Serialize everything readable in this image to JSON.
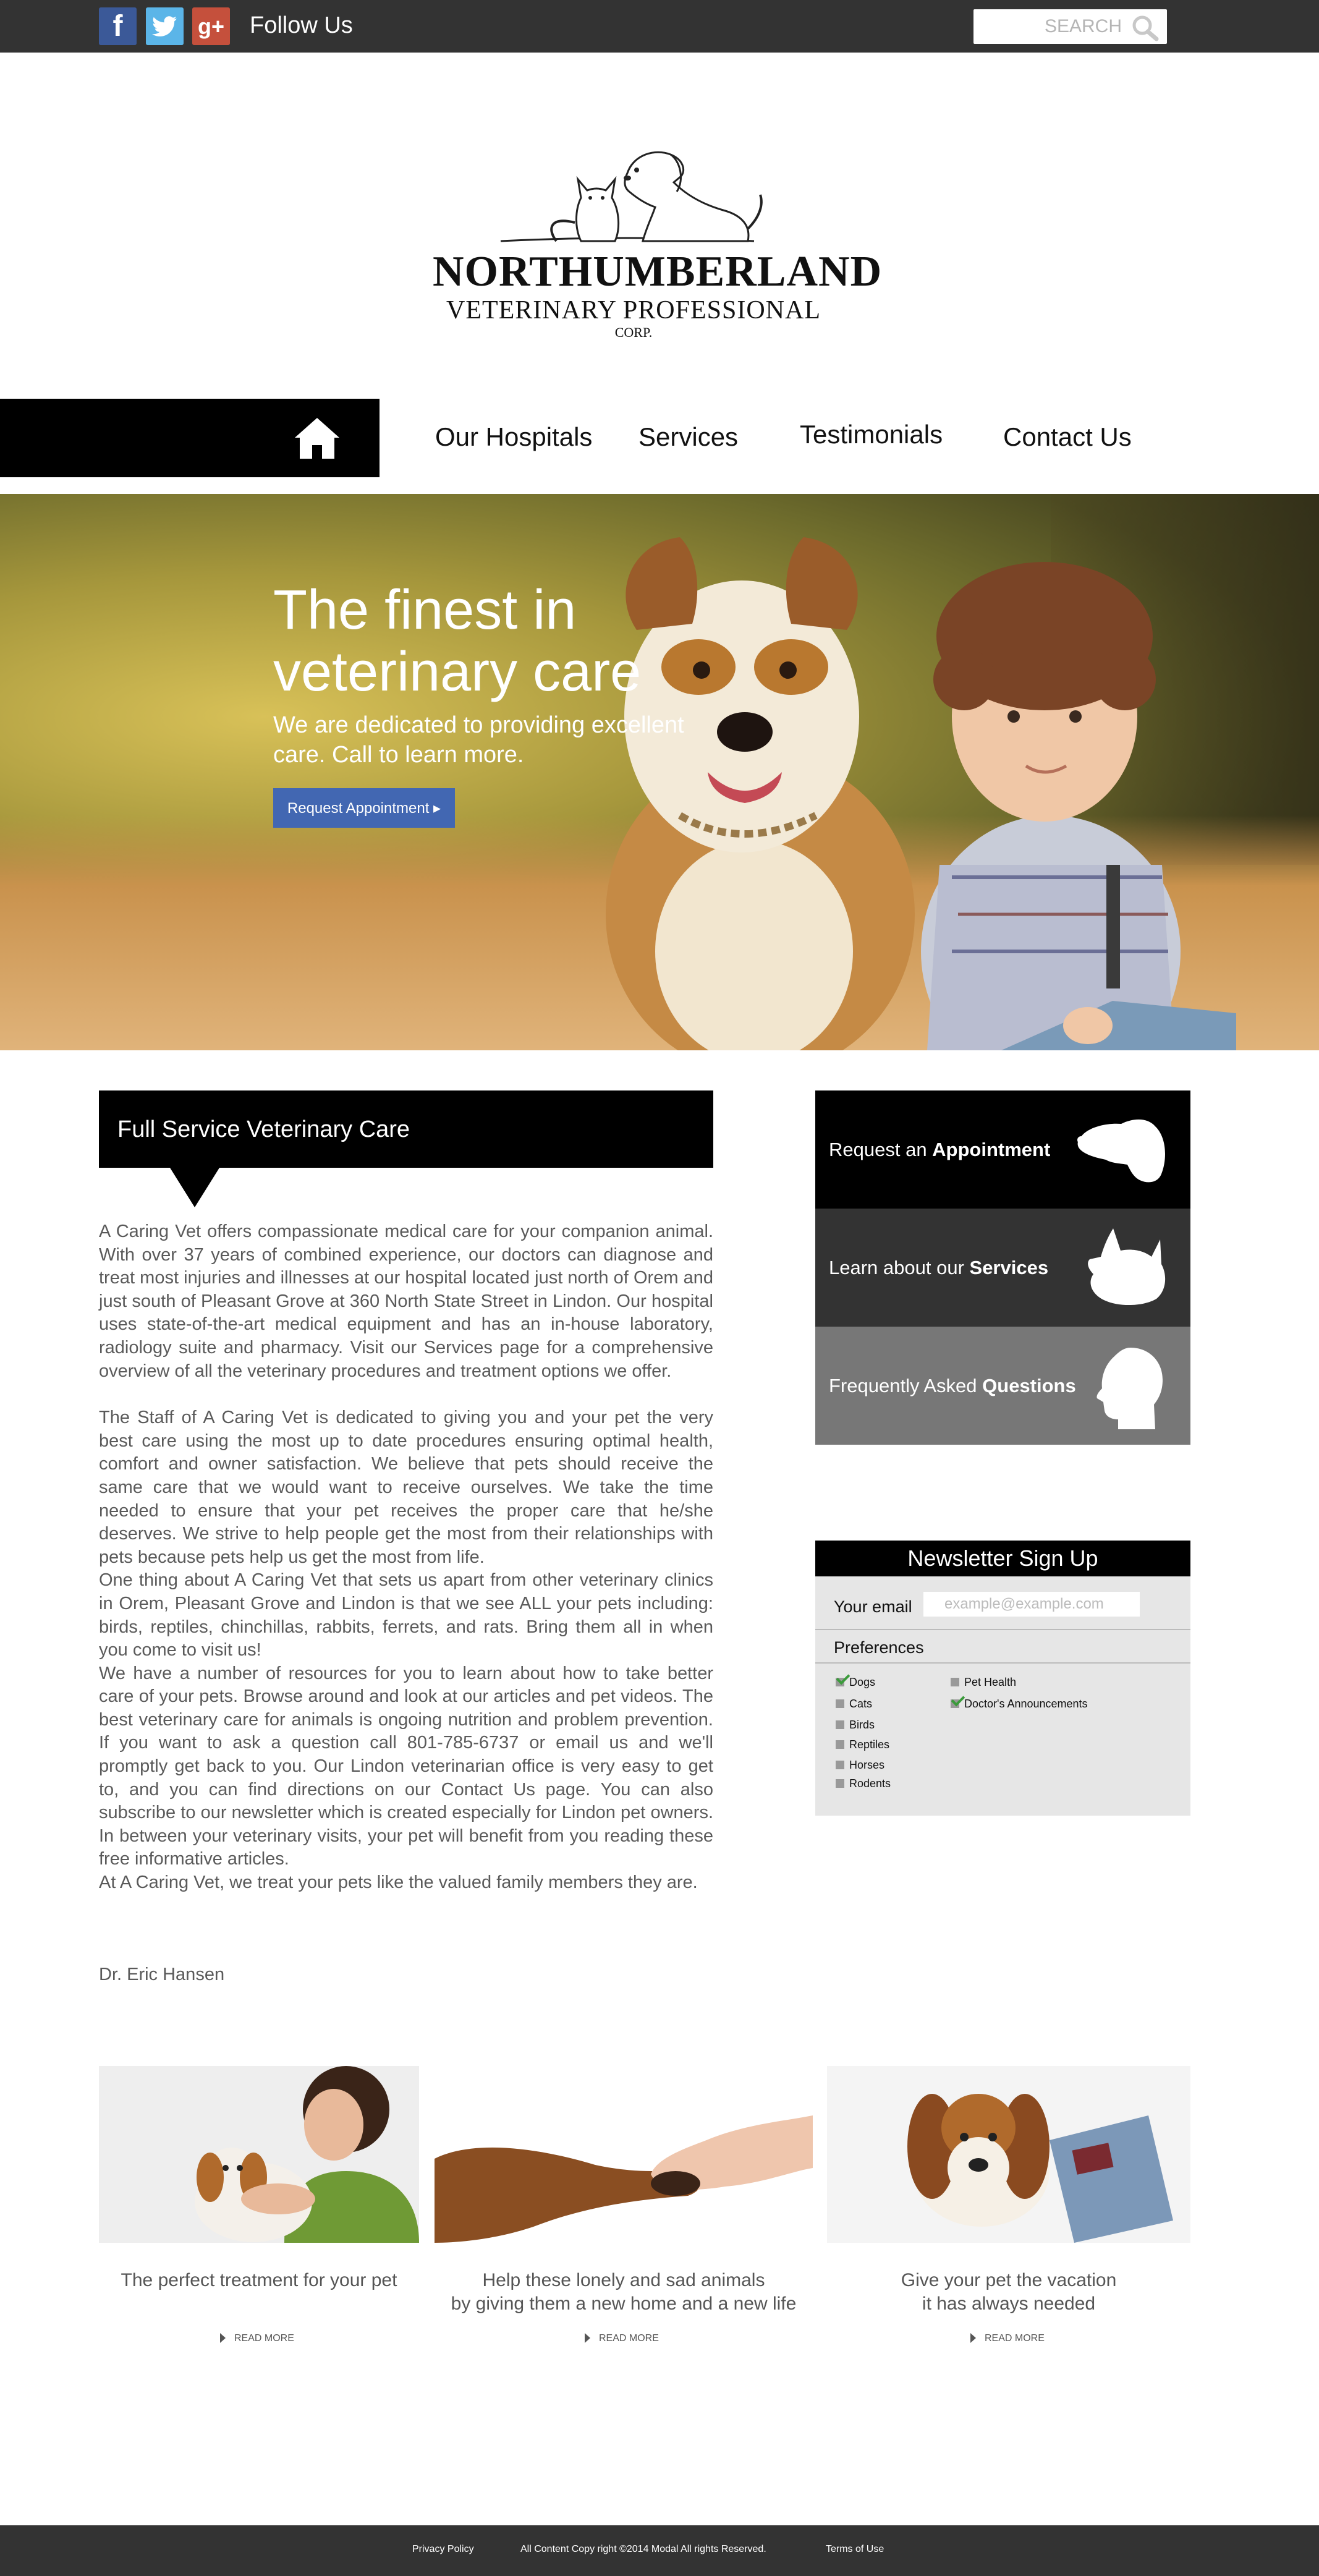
{
  "topbar": {
    "social": [
      {
        "name": "facebook",
        "glyph": "f"
      },
      {
        "name": "twitter",
        "glyph": ""
      },
      {
        "name": "google-plus",
        "glyph": "g+"
      }
    ],
    "follow_label": "Follow Us",
    "search_placeholder": "SEARCH"
  },
  "logo": {
    "name": "NORTHUMBERLAND",
    "subtitle": "VETERINARY PROFESSIONAL",
    "corp": "CORP."
  },
  "nav": {
    "items": [
      "Our Hospitals",
      "Services",
      "Testimonials",
      "Contact Us"
    ]
  },
  "hero": {
    "title": "The finest in veterinary care",
    "subtitle": "We are dedicated to providing excellent care. Call to learn more.",
    "button_label": "Request Appointment ▸"
  },
  "main": {
    "section_title": "Full Service Veterinary Care",
    "paragraphs": [
      "A Caring Vet offers compassionate medical care for your companion animal.  With over 37 years of combined experience, our doctors can diagnose and treat most injuries and illnesses at our hospital located just north of Orem and just south of Pleasant Grove at 360 North State Street in Lindon.  Our hospital uses state-of-the-art medical equipment and has an in-house laboratory, radiology suite and pharmacy.  Visit our Services page for a comprehensive overview of all the veterinary procedures and treatment options we offer.",
      "The Staff of A Caring Vet is dedicated to giving you and your pet the very best care using the most up to date procedures ensuring optimal health, comfort and owner satisfaction.  We believe that pets should receive the same care that we would want to receive ourselves.  We take the time needed to ensure that your pet receives the proper care that he/she deserves.  We strive to help people get the most from their relationships with pets because pets help us get the most from life.",
      "One thing about A Caring Vet that sets us apart from other veterinary clinics in Orem, Pleasant Grove and Lindon is that we see ALL your pets including: birds, reptiles, chinchillas, rabbits, ferrets, and rats. Bring them all in when you come to visit us!",
      "We have a number of resources for you to learn about how to take better care of your pets. Browse around and look at our articles and pet videos. The best veterinary care for animals is ongoing nutrition and problem prevention. If you want to ask a question call 801-785-6737 or email us and we'll promptly get back to you. Our Lindon veterinarian office is very easy to get to, and you can find directions on our Contact Us page. You can also subscribe to our newsletter which is created especially for Lindon pet owners. In between your veterinary visits, your pet will benefit from you reading these free informative articles.",
      "At A Caring Vet, we treat your pets like the valued family members they are."
    ],
    "signature": "Dr. Eric Hansen"
  },
  "sidebar": {
    "blocks": [
      {
        "prefix": "Request an ",
        "bold": "Appointment",
        "bg": "#000000",
        "icon": "dog-head-icon"
      },
      {
        "prefix": "Learn about our ",
        "bold": "Services",
        "bg": "#333333",
        "icon": "cat-head-icon"
      },
      {
        "prefix": "Frequently Asked ",
        "bold": "Questions",
        "bg": "#777777",
        "icon": "human-head-icon"
      }
    ]
  },
  "newsletter": {
    "title": "Newsletter Sign Up",
    "email_label": "Your email",
    "email_placeholder": "example@example.com",
    "preferences_label": "Preferences",
    "options_left": [
      {
        "label": "Dogs",
        "checked": true
      },
      {
        "label": "Cats",
        "checked": false
      },
      {
        "label": "Birds",
        "checked": false
      },
      {
        "label": "Reptiles",
        "checked": false
      },
      {
        "label": "Horses",
        "checked": false
      },
      {
        "label": "Rodents",
        "checked": false
      }
    ],
    "options_right": [
      {
        "label": "Pet Health",
        "checked": false
      },
      {
        "label": "Doctor's Announcements",
        "checked": true
      }
    ]
  },
  "features": [
    {
      "caption_line1": "The perfect treatment for your pet",
      "caption_line2": "",
      "read_more": "READ MORE"
    },
    {
      "caption_line1": "Help these lonely and sad animals",
      "caption_line2": "by giving them a new home and a new life",
      "read_more": "READ MORE"
    },
    {
      "caption_line1": "Give your pet the vacation",
      "caption_line2": "it has always needed",
      "read_more": "READ MORE"
    }
  ],
  "footer": {
    "privacy": "Privacy Policy",
    "copyright": "All Content Copy right ©2014 Modal All rights Reserved.",
    "terms": "Terms of Use"
  },
  "colors": {
    "topbar": "#333333",
    "nav_home": "#000000",
    "hero_button": "#4267b2",
    "facebook": "#3b5998",
    "twitter": "#5bb5e8",
    "google_plus": "#c5503c",
    "checkmark": "#3a9b3a"
  }
}
